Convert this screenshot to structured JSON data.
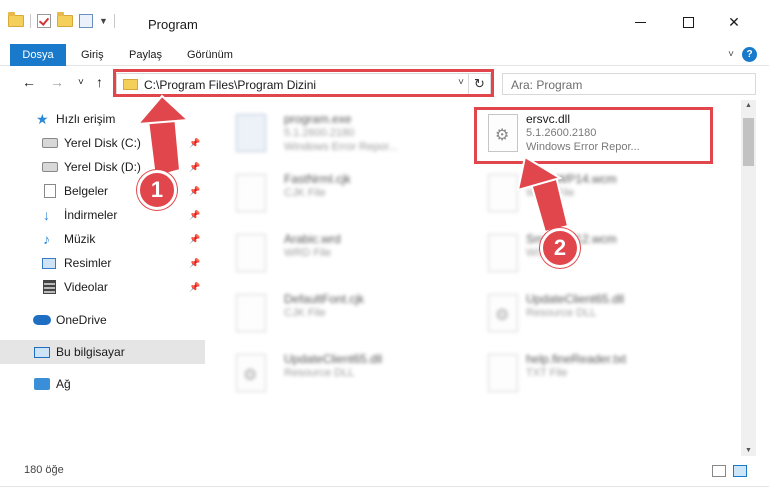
{
  "window": {
    "title": "Program",
    "minimize_icon": "minimize-icon",
    "maximize_icon": "maximize-icon",
    "close_glyph": "✕"
  },
  "ribbon": {
    "tabs": [
      "Dosya",
      "Giriş",
      "Paylaş",
      "Görünüm"
    ],
    "help_glyph": "?",
    "expand_glyph": "˅",
    "accent_color": "#1979ca"
  },
  "nav": {
    "back_glyph": "←",
    "forward_glyph": "→",
    "recent_glyph": "˅",
    "up_glyph": "↑",
    "address": "C:\\Program Files\\Program Dizini",
    "address_dropdown_glyph": "˅",
    "refresh_glyph": "↻",
    "search_placeholder": "Ara: Program"
  },
  "sidebar": {
    "items": [
      {
        "label": "Hızlı erişim",
        "icon": "quick-access-star-icon",
        "pinned": false
      },
      {
        "label": "Yerel Disk (C:)",
        "icon": "local-disk-icon",
        "pinned": true
      },
      {
        "label": "Yerel Disk (D:)",
        "icon": "local-disk-icon",
        "pinned": true
      },
      {
        "label": "Belgeler",
        "icon": "documents-icon",
        "pinned": true
      },
      {
        "label": "İndirmeler",
        "icon": "downloads-icon",
        "pinned": true
      },
      {
        "label": "Müzik",
        "icon": "music-icon",
        "pinned": true
      },
      {
        "label": "Resimler",
        "icon": "pictures-icon",
        "pinned": true
      },
      {
        "label": "Videolar",
        "icon": "videos-icon",
        "pinned": true
      },
      {
        "label": "OneDrive",
        "icon": "onedrive-icon",
        "pinned": false
      },
      {
        "label": "Bu bilgisayar",
        "icon": "this-pc-icon",
        "pinned": false
      },
      {
        "label": "Ağ",
        "icon": "network-icon",
        "pinned": false
      }
    ],
    "pin_glyph": "📌"
  },
  "files": [
    {
      "name": "program.exe",
      "meta1": "5.1.2600.2180",
      "meta2": "Windows Error Repor...",
      "icon": "exe-file-icon",
      "blurred": true
    },
    {
      "name": "ersvc.dll",
      "meta1": "5.1.2600.2180",
      "meta2": "Windows Error Repor...",
      "icon": "dll-gear-icon",
      "blurred": false
    },
    {
      "name": "FastNrml.cjk",
      "meta1": "CJK File",
      "meta2": "",
      "icon": "blank-file-icon",
      "blurred": true
    },
    {
      "name": "SmallWP14.wcm",
      "meta1": "WCM File",
      "meta2": "",
      "icon": "blank-file-icon",
      "blurred": true
    },
    {
      "name": "Arabic.wrd",
      "meta1": "WRD File",
      "meta2": "",
      "icon": "blank-file-icon",
      "blurred": true
    },
    {
      "name": "SmallWP12.wcm",
      "meta1": "WCM File",
      "meta2": "",
      "icon": "blank-file-icon",
      "blurred": true
    },
    {
      "name": "DefaultFont.cjk",
      "meta1": "CJK File",
      "meta2": "",
      "icon": "blank-file-icon",
      "blurred": true
    },
    {
      "name": "UpdateClient65.dll",
      "meta1": "Resource DLL",
      "meta2": "",
      "icon": "dll-gear-icon",
      "blurred": true
    },
    {
      "name": "UpdateClient65.dll",
      "meta1": "Resource DLL",
      "meta2": "",
      "icon": "dll-gear-icon",
      "blurred": true
    },
    {
      "name": "help.fineReader.txt",
      "meta1": "TXT File",
      "meta2": "",
      "icon": "blank-file-icon",
      "blurred": true
    }
  ],
  "callouts": [
    "1",
    "2"
  ],
  "highlight_color": "#e0464b",
  "status": {
    "item_count": "180 öğe"
  }
}
